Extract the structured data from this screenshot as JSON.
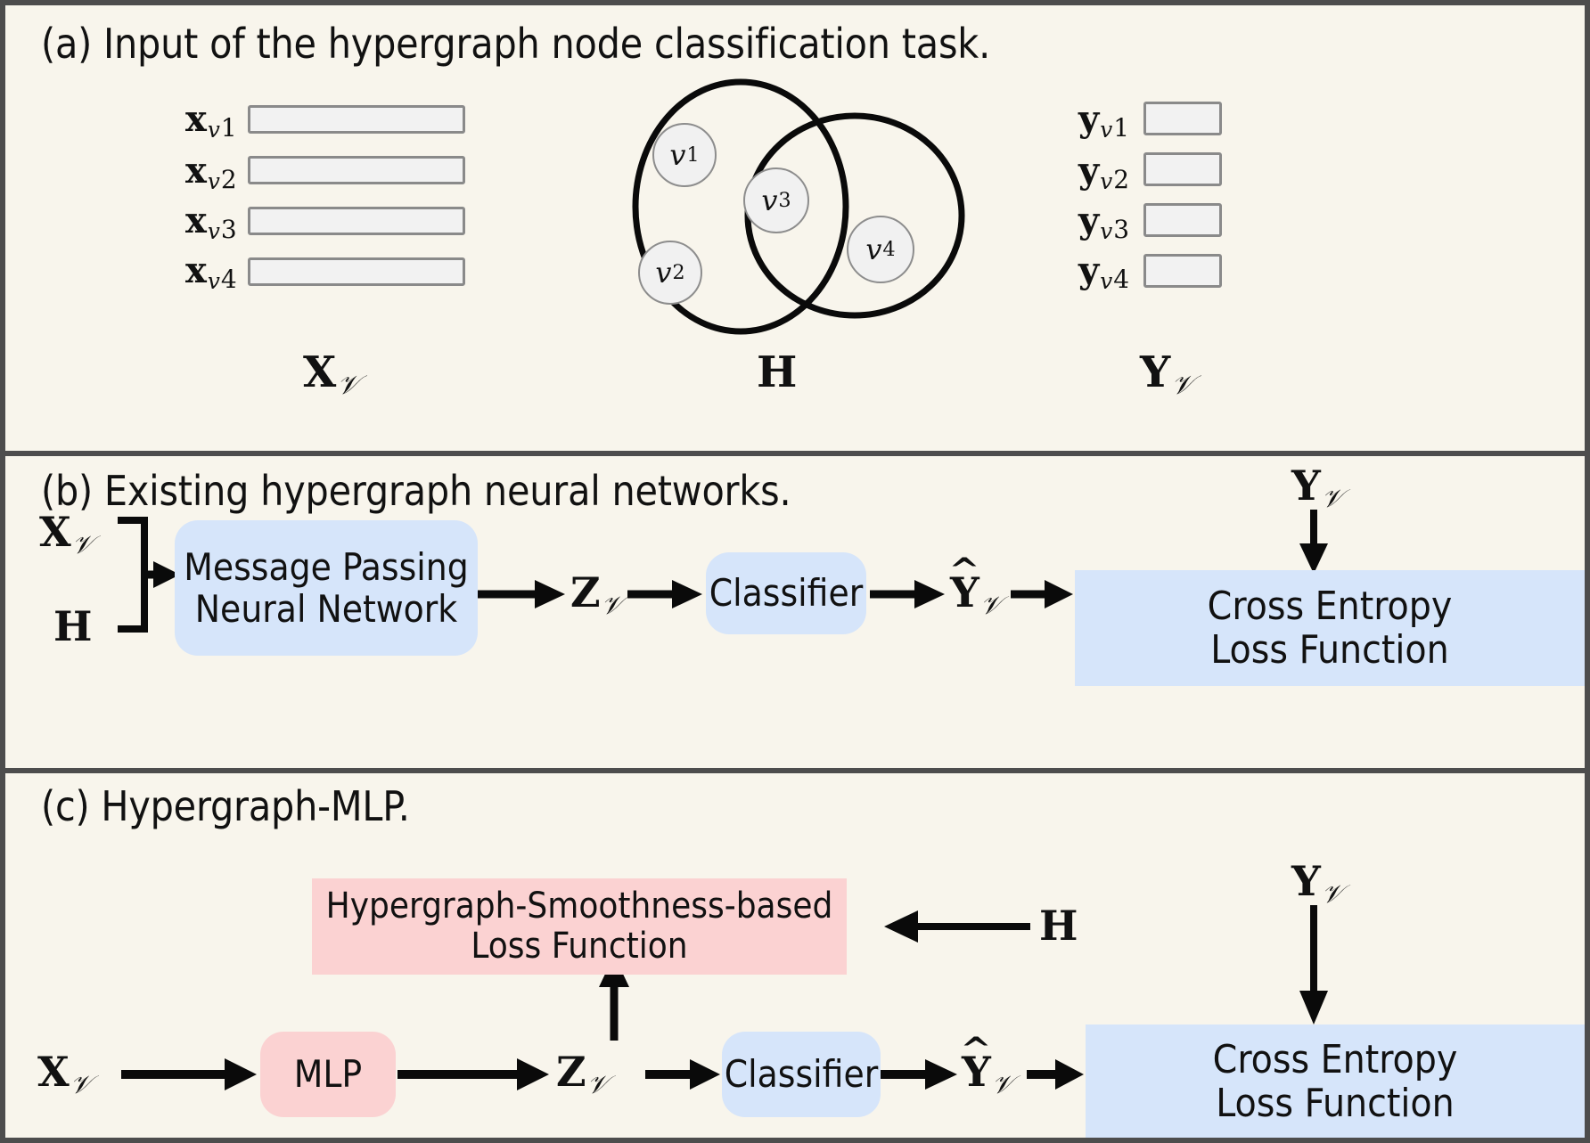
{
  "figure": {
    "background_color": "#f8f5ec",
    "border_color": "#4d4d4d",
    "blue_box_color": "#d6e5fa",
    "pink_box_color": "#fbd2d2",
    "vector_box_fill": "#f2f2f2",
    "vector_box_border": "#8a8a8a"
  },
  "panel_a": {
    "caption": "(a) Input of the hypergraph node classification task.",
    "feature_labels": [
      {
        "symbol": "x",
        "sub": "v",
        "idx": "1"
      },
      {
        "symbol": "x",
        "sub": "v",
        "idx": "2"
      },
      {
        "symbol": "x",
        "sub": "v",
        "idx": "3"
      },
      {
        "symbol": "x",
        "sub": "v",
        "idx": "4"
      }
    ],
    "label_labels": [
      {
        "symbol": "y",
        "sub": "v",
        "idx": "1"
      },
      {
        "symbol": "y",
        "sub": "v",
        "idx": "2"
      },
      {
        "symbol": "y",
        "sub": "v",
        "idx": "3"
      },
      {
        "symbol": "y",
        "sub": "v",
        "idx": "4"
      }
    ],
    "nodes": [
      {
        "symbol": "v",
        "idx": "1"
      },
      {
        "symbol": "v",
        "idx": "2"
      },
      {
        "symbol": "v",
        "idx": "3"
      },
      {
        "symbol": "v",
        "idx": "4"
      }
    ],
    "hyperedges": 2,
    "bottom_labels": {
      "features": {
        "symbol": "X",
        "sub": "𝒱"
      },
      "incidence": {
        "symbol": "H",
        "sub": ""
      },
      "labels": {
        "symbol": "Y",
        "sub": "𝒱"
      }
    }
  },
  "panel_b": {
    "caption": "(b) Existing hypergraph neural networks.",
    "inputs": [
      {
        "symbol": "X",
        "sub": "𝒱"
      },
      {
        "symbol": "H",
        "sub": ""
      }
    ],
    "mpnn_box": {
      "line1": "Message Passing",
      "line2": "Neural Network",
      "color": "#d6e5fa"
    },
    "embedding": {
      "symbol": "Z",
      "sub": "𝒱"
    },
    "classifier_box": {
      "label": "Classifier",
      "color": "#d6e5fa"
    },
    "prediction": {
      "symbol": "Y",
      "sub": "𝒱",
      "hat": true
    },
    "supervision": {
      "symbol": "Y",
      "sub": "𝒱"
    },
    "loss_box": {
      "line1": "Cross Entropy",
      "line2": "Loss Function",
      "color": "#d6e5fa"
    }
  },
  "panel_c": {
    "caption": "(c) Hypergraph-MLP.",
    "smoothness_box": {
      "line1": "Hypergraph-Smoothness-based",
      "line2": "Loss Function",
      "color": "#fbd2d2"
    },
    "incidence": {
      "symbol": "H",
      "sub": ""
    },
    "input": {
      "symbol": "X",
      "sub": "𝒱"
    },
    "mlp_box": {
      "label": "MLP",
      "color": "#fbd2d2"
    },
    "embedding": {
      "symbol": "Z",
      "sub": "𝒱"
    },
    "classifier_box": {
      "label": "Classifier",
      "color": "#d6e5fa"
    },
    "prediction": {
      "symbol": "Y",
      "sub": "𝒱",
      "hat": true
    },
    "supervision": {
      "symbol": "Y",
      "sub": "𝒱"
    },
    "loss_box": {
      "line1": "Cross Entropy",
      "line2": "Loss Function",
      "color": "#d6e5fa"
    }
  }
}
